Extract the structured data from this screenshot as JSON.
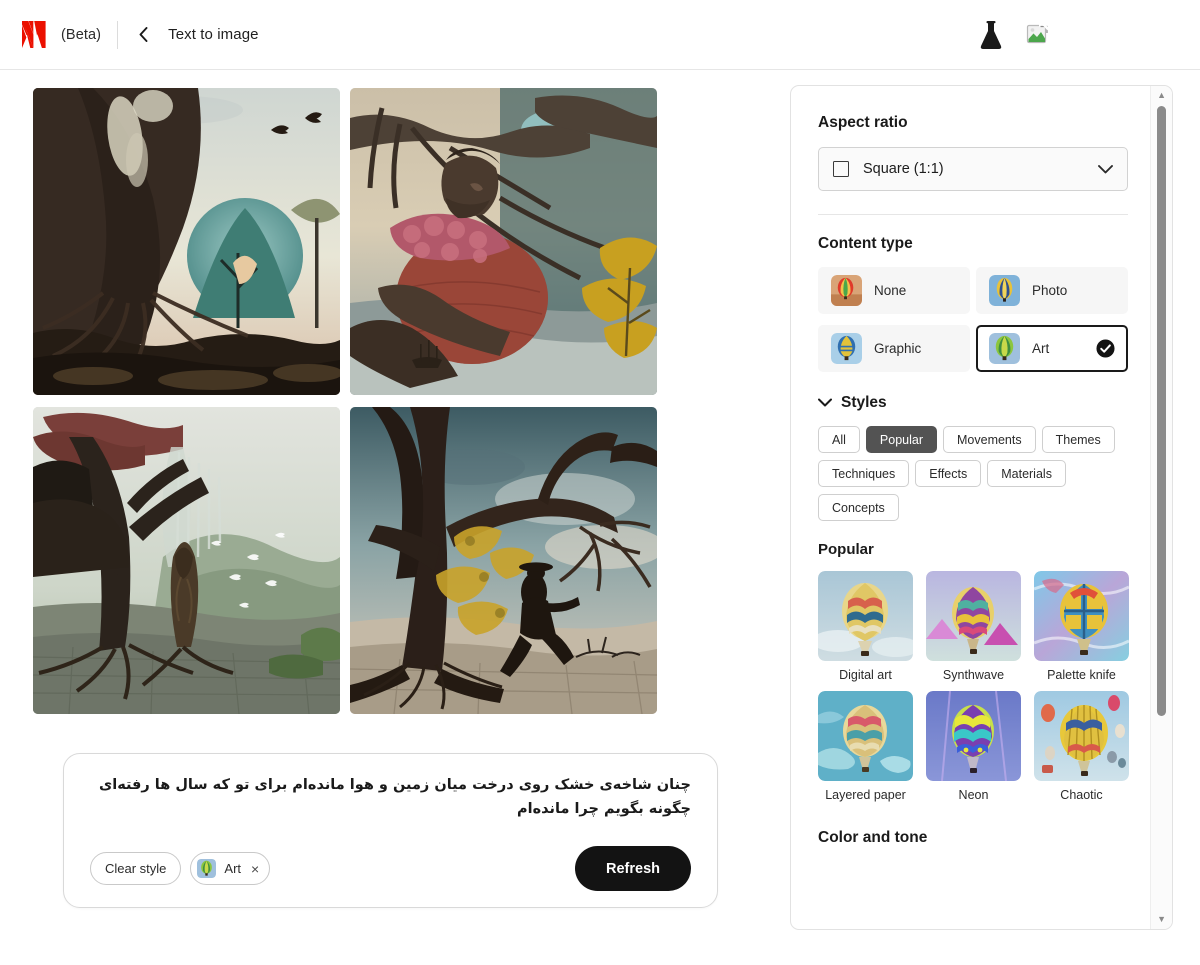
{
  "header": {
    "beta_label": "(Beta)",
    "back_icon": "chevron-left-icon",
    "title": "Text to image",
    "beaker_icon": "beaker-icon",
    "broken_image_icon": "broken-image-icon"
  },
  "gallery": {
    "images": [
      {
        "alt": "Surreal giant tree with exposed roots, glowing moon face and birds"
      },
      {
        "alt": "Woman formed from tree branches with pink blossoms over a misty lake"
      },
      {
        "alt": "Forked tree with waterfalls, birds and a figure in a cracked landscape"
      },
      {
        "alt": "Person in hat seated on twisted tree branch above a desert"
      }
    ]
  },
  "prompt": {
    "text": "چنان شاخه‌ی خشک روی درخت میان زمین و هوا مانده‌ام برای تو که سال ها رفته‌ای چگونه بگویم چرا مانده‌ام",
    "clear_style_label": "Clear style",
    "style_chip_label": "Art",
    "style_chip_remove": "×",
    "refresh_label": "Refresh"
  },
  "panel": {
    "aspect_ratio": {
      "title": "Aspect ratio",
      "selected": "Square (1:1)",
      "square_icon": "square-icon",
      "chevron_icon": "chevron-down-icon"
    },
    "content_type": {
      "title": "Content type",
      "options": [
        {
          "label": "None",
          "selected": false
        },
        {
          "label": "Photo",
          "selected": false
        },
        {
          "label": "Graphic",
          "selected": false
        },
        {
          "label": "Art",
          "selected": true
        }
      ],
      "check_icon": "check-circle-icon"
    },
    "styles": {
      "title": "Styles",
      "collapse_icon": "chevron-down-icon",
      "filters": [
        {
          "label": "All",
          "active": false
        },
        {
          "label": "Popular",
          "active": true
        },
        {
          "label": "Movements",
          "active": false
        },
        {
          "label": "Themes",
          "active": false
        },
        {
          "label": "Techniques",
          "active": false
        },
        {
          "label": "Effects",
          "active": false
        },
        {
          "label": "Materials",
          "active": false
        },
        {
          "label": "Concepts",
          "active": false
        }
      ],
      "group_title": "Popular",
      "items": [
        {
          "label": "Digital art"
        },
        {
          "label": "Synthwave"
        },
        {
          "label": "Palette knife"
        },
        {
          "label": "Layered paper"
        },
        {
          "label": "Neon"
        },
        {
          "label": "Chaotic"
        }
      ]
    },
    "color_and_tone": {
      "title": "Color and tone"
    },
    "scrollbar": {
      "up_arrow": "▲",
      "down_arrow": "▼"
    }
  },
  "colors": {
    "accent_dark": "#131313",
    "chip_active": "#535353",
    "adobe_red": "#EB1000",
    "panel_border": "#e2e2e2"
  }
}
